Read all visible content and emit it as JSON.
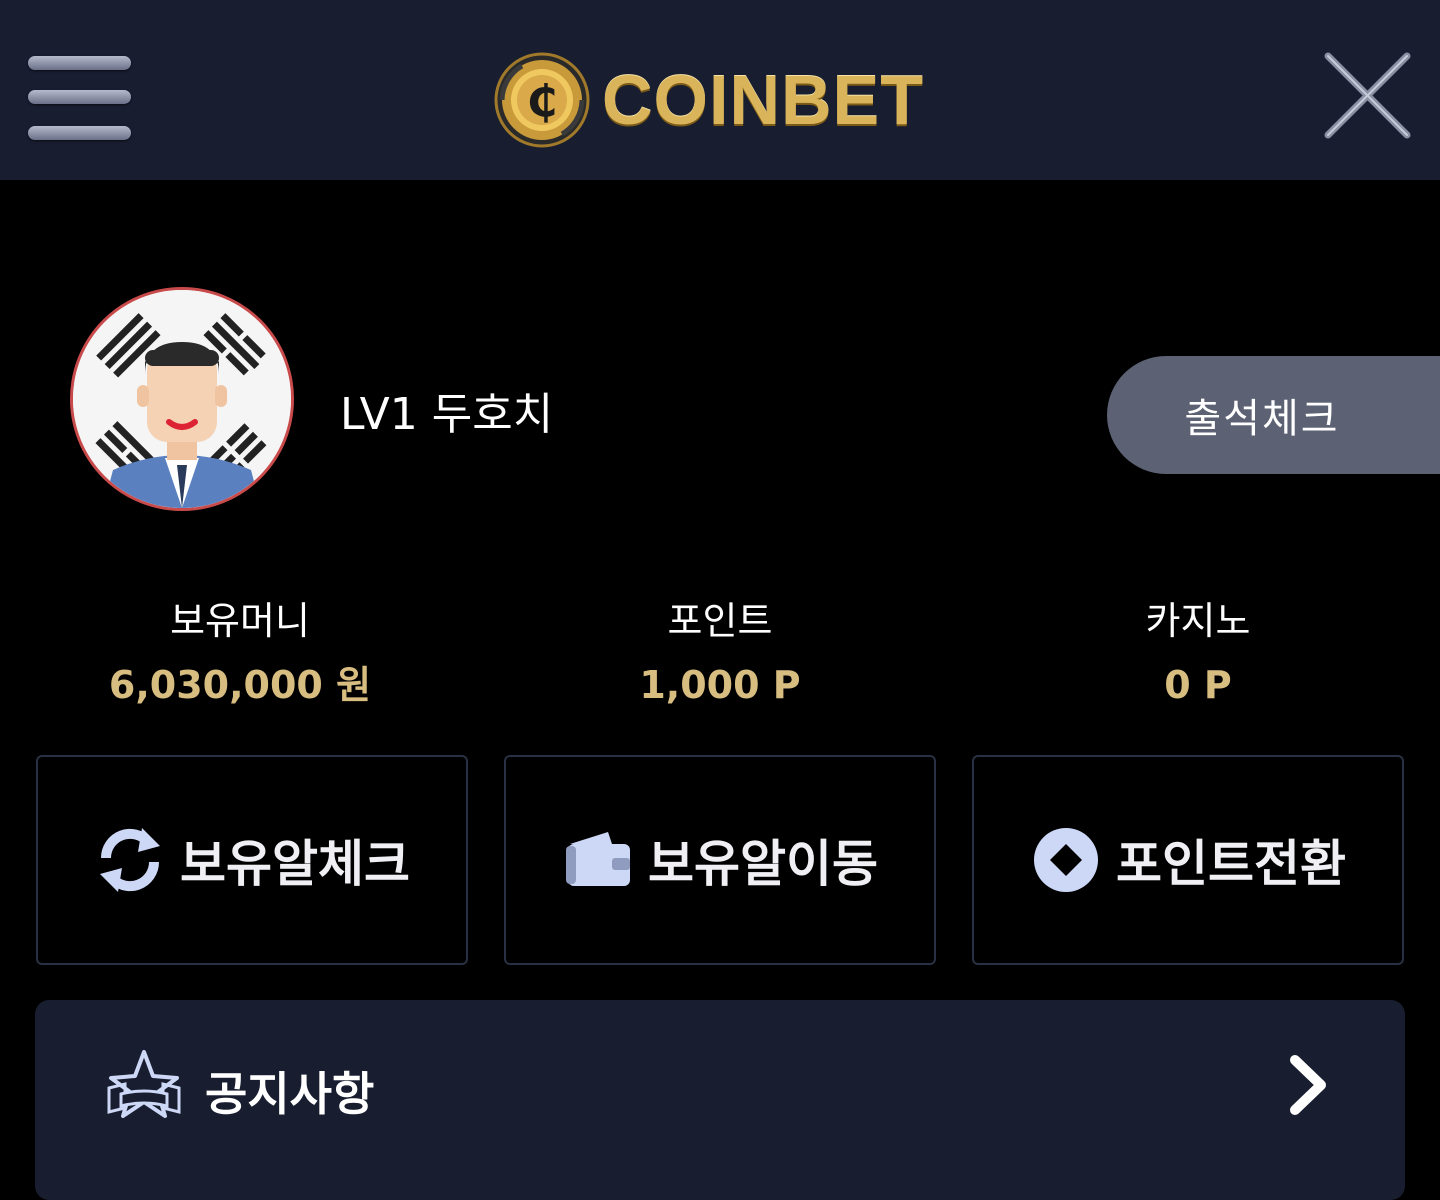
{
  "header": {
    "logo_text": "COINBET",
    "logo_symbol": "₵",
    "menu_icon": "hamburger-menu-icon",
    "close_icon": "close-icon"
  },
  "profile": {
    "username": "LV1 두호치",
    "attendance_label": "출석체크"
  },
  "stats": [
    {
      "label": "보유머니",
      "value": "6,030,000 원"
    },
    {
      "label": "포인트",
      "value": "1,000 P"
    },
    {
      "label": "카지노",
      "value": "0 P"
    }
  ],
  "actions": [
    {
      "label": "보유알체크",
      "icon": "refresh-icon"
    },
    {
      "label": "보유알이동",
      "icon": "wallet-icon"
    },
    {
      "label": "포인트전환",
      "icon": "diamond-circle-icon"
    }
  ],
  "notice": {
    "label": "공지사항",
    "icon": "star-badge-icon"
  },
  "colors": {
    "header_bg": "#181d30",
    "page_bg": "#000000",
    "gold": "#d9b45b",
    "value_text": "#d8bd80",
    "attendance_bg": "#5c6173",
    "icon_blue": "#cdd8f6"
  }
}
